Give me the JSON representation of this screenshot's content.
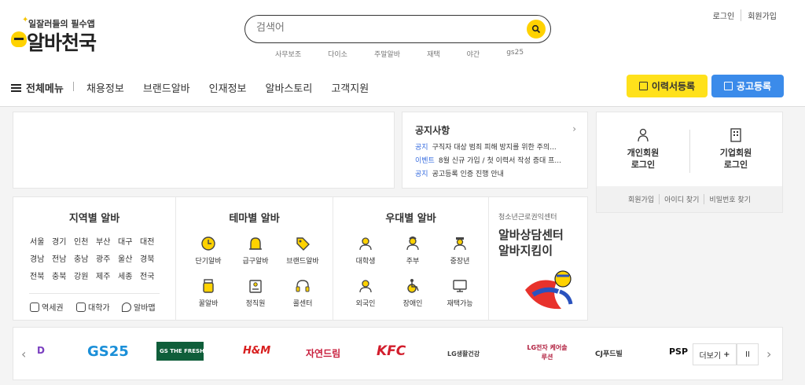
{
  "header": {
    "logo_tagline": "일잘러들의 필수앱",
    "logo_name": "알바천국",
    "search_placeholder": "검색어",
    "keywords": [
      "사무보조",
      "다이소",
      "주말알바",
      "재택",
      "야간",
      "gs25"
    ],
    "auth": {
      "login": "로그인",
      "signup": "회원가입"
    }
  },
  "nav": {
    "all_menu": "전체메뉴",
    "links": [
      "채용정보",
      "브랜드알바",
      "인재정보",
      "알바스토리",
      "고객지원"
    ],
    "resume_button": "이력서등록",
    "post_button": "공고등록"
  },
  "notice": {
    "title": "공지사항",
    "items": [
      {
        "kind": "공지",
        "text": "구직자 대상 범죄 피해 방지를 위한 주의..."
      },
      {
        "kind": "이벤트",
        "text": "8월 신규 가입 / 첫 이력서 작성 증대 프..."
      },
      {
        "kind": "공지",
        "text": "공고등록 인증 진행 안내"
      }
    ]
  },
  "login": {
    "personal": "개인회원\n로그인",
    "personal_l1": "개인회원",
    "personal_l2": "로그인",
    "company_l1": "기업회원",
    "company_l2": "로그인",
    "links": [
      "회원가입",
      "아이디 찾기",
      "비밀번호 찾기"
    ]
  },
  "categories": {
    "region": {
      "title": "지역별 알바",
      "rows": [
        [
          "서울",
          "경기",
          "인천",
          "부산",
          "대구",
          "대전"
        ],
        [
          "경남",
          "전남",
          "충남",
          "광주",
          "울산",
          "경북"
        ],
        [
          "전북",
          "충북",
          "강원",
          "제주",
          "세종",
          "전국"
        ]
      ],
      "quick": [
        "역세권",
        "대학가",
        "알바맵"
      ]
    },
    "theme": {
      "title": "테마별 알바",
      "items": [
        "단기알바",
        "급구알바",
        "브랜드알바",
        "꿀알바",
        "정직원",
        "콜센터"
      ]
    },
    "favor": {
      "title": "우대별 알바",
      "items": [
        "대학생",
        "주부",
        "중장년",
        "외국인",
        "장애인",
        "재택가능"
      ]
    },
    "center": {
      "sub": "청소년근로권익센터",
      "title_l1": "알바상담센터",
      "title_l2": "알바지킴이"
    }
  },
  "brands": {
    "items": [
      "D",
      "GS25",
      "GS THE FRESH",
      "H&M",
      "자연드림",
      "KFC",
      "LG생활건강",
      "LG전자 케어솔루션",
      "CJ푸드빌",
      "PSP"
    ],
    "more": "더보기",
    "pause": "II"
  },
  "colors": {
    "yellow": "#ffe11b",
    "blue": "#3b8bea"
  }
}
